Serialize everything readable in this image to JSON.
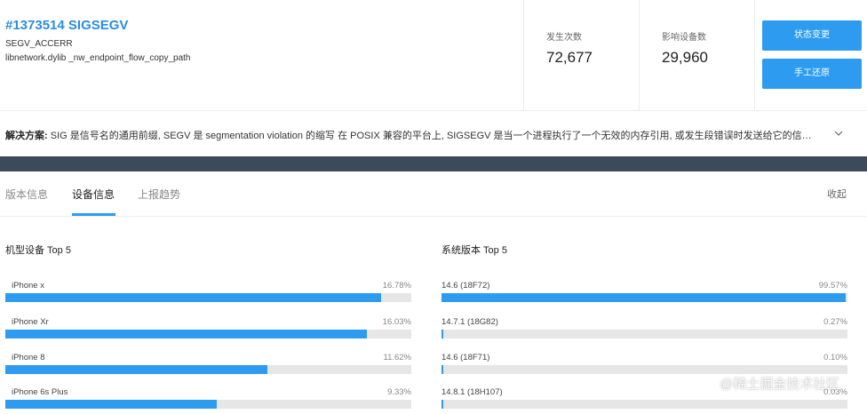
{
  "issue": {
    "id_title": "#1373514 SIGSEGV",
    "type": "SEGV_ACCERR",
    "frame": "libnetwork.dylib _nw_endpoint_flow_copy_path"
  },
  "stats": {
    "occurrences_label": "发生次数",
    "occurrences_value": "72,677",
    "devices_label": "影响设备数",
    "devices_value": "29,960"
  },
  "actions": {
    "change_status": "状态变更",
    "manual_restore": "手工还原"
  },
  "solution": {
    "label": "解决方案:",
    "text": "SIG 是信号名的通用前缀, SEGV 是 segmentation violation 的缩写 在 POSIX 兼容的平台上, SIGSEGV 是当一个进程执行了一个无效的内存引用, 或发生段错误时发送给它的信…"
  },
  "tabs": [
    {
      "label": "版本信息",
      "active": false
    },
    {
      "label": "设备信息",
      "active": true
    },
    {
      "label": "上报趋势",
      "active": false
    }
  ],
  "collapse_label": "收起",
  "device_top": {
    "title": "机型设备 Top 5",
    "items": [
      {
        "name": "iPhone x",
        "percent": "16.78%",
        "fraction": 0.925
      },
      {
        "name": "iPhone Xr",
        "percent": "16.03%",
        "fraction": 0.89
      },
      {
        "name": "iPhone 8",
        "percent": "11.62%",
        "fraction": 0.645
      },
      {
        "name": "iPhone 6s Plus",
        "percent": "9.33%",
        "fraction": 0.52
      }
    ]
  },
  "os_top": {
    "title": "系统版本 Top 5",
    "items": [
      {
        "name": "14.6 (18F72)",
        "percent": "99.57%",
        "fraction": 0.996
      },
      {
        "name": "14.7.1 (18G82)",
        "percent": "0.27%",
        "fraction": 0.003
      },
      {
        "name": "14.6 (18F71)",
        "percent": "0.10%",
        "fraction": 0.002
      },
      {
        "name": "14.8.1 (18H107)",
        "percent": "0.03%",
        "fraction": 0.001
      }
    ]
  },
  "watermark": "@稀土掘金技术社区",
  "colors": {
    "accent": "#2d9cf0",
    "band": "#3d4a5c",
    "track": "#e6e6e6"
  }
}
